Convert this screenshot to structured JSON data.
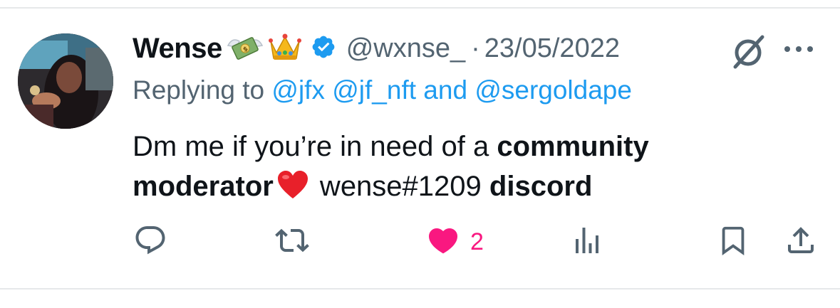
{
  "tweet": {
    "display_name": "Wense",
    "name_emojis": [
      "money-with-wings-emoji",
      "crown-emoji"
    ],
    "verified": true,
    "handle": "@wxnse_",
    "separator": "·",
    "date": "23/05/2022",
    "replying_prefix": "Replying to",
    "replying_to": [
      "@jfx",
      "@jf_nft"
    ],
    "replying_and": "and",
    "replying_last": "@sergoldape",
    "text_parts": [
      "Dm me if you’re in need of a ",
      "community moderator",
      " wense#1209 ",
      "discord"
    ],
    "inline_emoji": "red-heart-emoji"
  },
  "actions": {
    "like_count": "2"
  },
  "colors": {
    "text": "#0f1419",
    "secondary": "#536471",
    "link": "#1d9bf0",
    "like": "#f91880",
    "divider": "#e6e8ea"
  },
  "icons": {
    "reply": "reply-icon",
    "retweet": "retweet-icon",
    "like": "heart-filled-icon",
    "views": "views-icon",
    "bookmark": "bookmark-icon",
    "share": "share-icon",
    "grok": "grok-icon",
    "more": "more-icon",
    "verified": "verified-badge-icon"
  }
}
